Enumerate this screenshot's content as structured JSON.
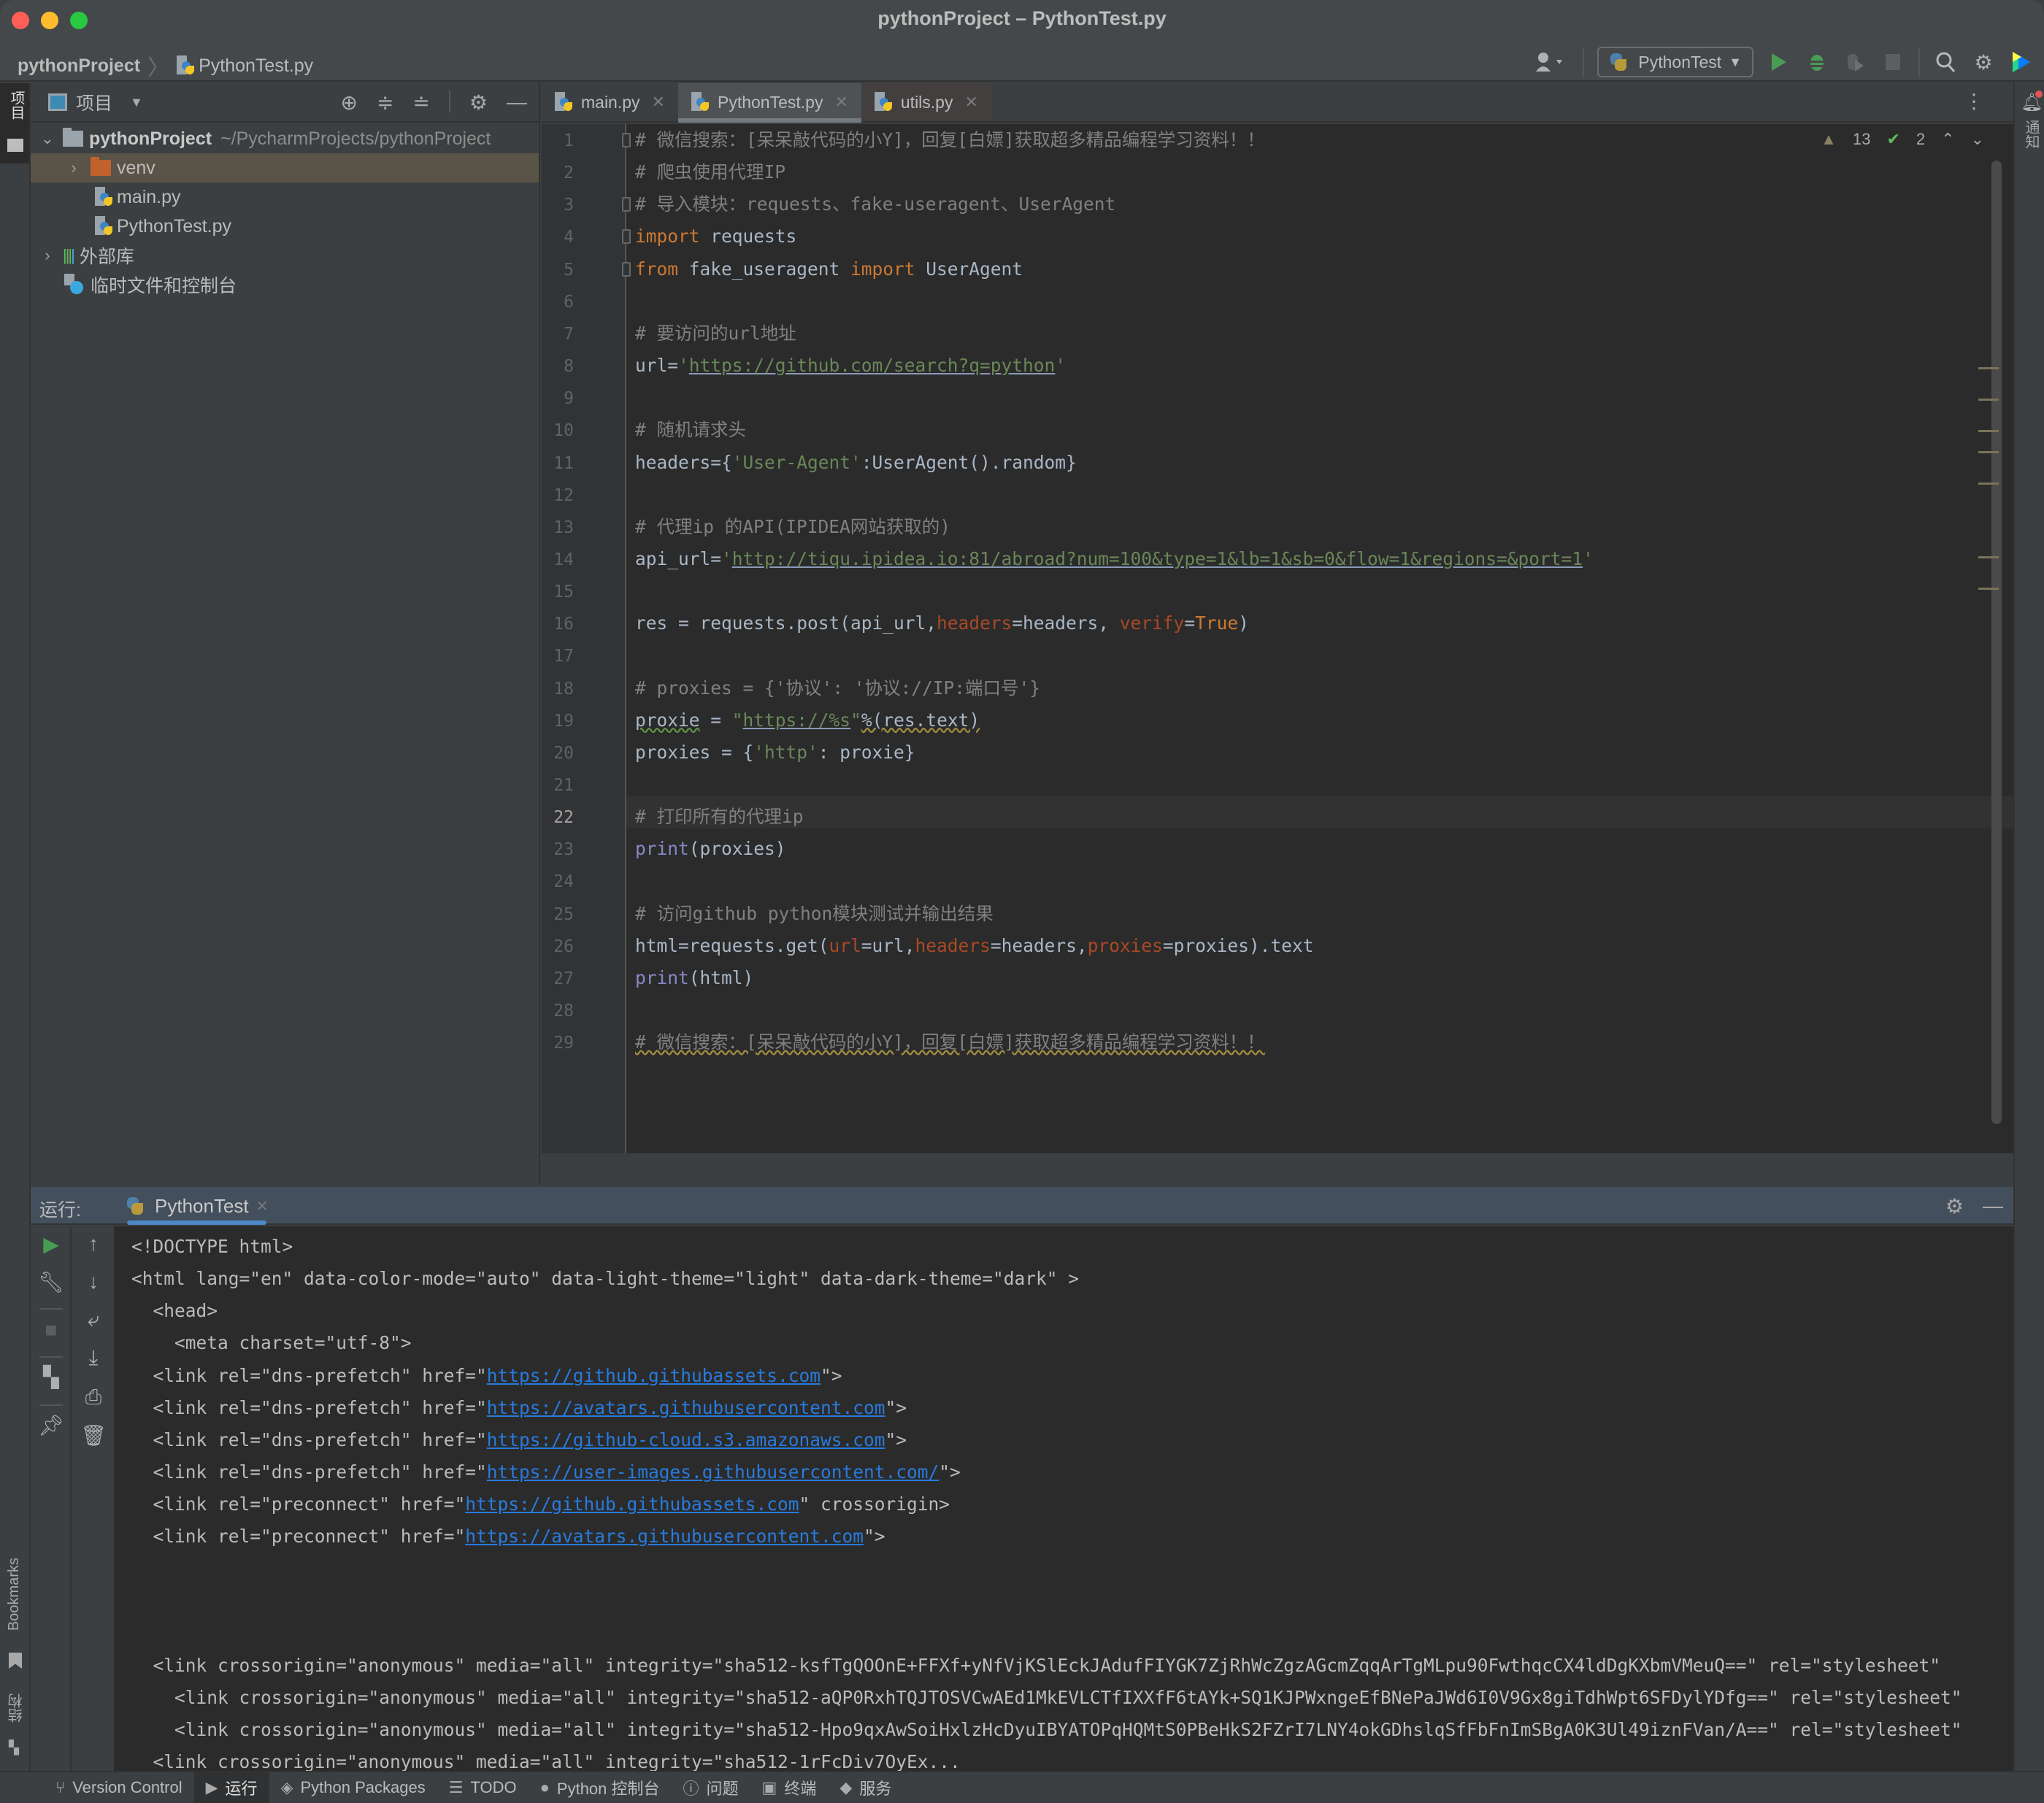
{
  "window": {
    "title": "pythonProject – PythonTest.py",
    "traffic_lights": {
      "close": "#ff5f57",
      "minimize": "#febc2e",
      "maximize": "#28c840"
    }
  },
  "navbar": {
    "breadcrumb": [
      "pythonProject",
      "PythonTest.py"
    ],
    "run_config": "PythonTest",
    "icons": [
      "user-icon",
      "run-icon",
      "debug-icon",
      "coverage-icon",
      "stop-icon",
      "search-icon",
      "settings-icon",
      "jetbrains-logo-icon"
    ]
  },
  "left_strip": {
    "top_label": "项目",
    "bottom_labels": [
      "Bookmarks",
      "结构"
    ]
  },
  "right_strip": {
    "label": "通知"
  },
  "project_panel": {
    "title": "项目",
    "tree": [
      {
        "label": "pythonProject",
        "path": "~/PycharmProjects/pythonProject",
        "type": "root",
        "expanded": true
      },
      {
        "label": "venv",
        "type": "folder",
        "expanded": false,
        "selected": true
      },
      {
        "label": "main.py",
        "type": "python-file"
      },
      {
        "label": "PythonTest.py",
        "type": "python-file"
      },
      {
        "label": "外部库",
        "type": "library",
        "expanded": false
      },
      {
        "label": "临时文件和控制台",
        "type": "scratches"
      }
    ]
  },
  "editor": {
    "tabs": [
      {
        "label": "main.py",
        "active": false
      },
      {
        "label": "PythonTest.py",
        "active": true
      },
      {
        "label": "utils.py",
        "active": false
      }
    ],
    "warnings": "13",
    "weak_warnings": "2",
    "current_line": 22,
    "lines": [
      {
        "n": "1",
        "text": "# 微信搜索：[呆呆敲代码的小Y]，回复[白嫖]获取超多精品编程学习资料！！"
      },
      {
        "n": "2",
        "text": "# 爬虫使用代理IP"
      },
      {
        "n": "3",
        "text": "# 导入模块：requests、fake-useragent、UserAgent"
      },
      {
        "n": "4",
        "kw": "import",
        "rest": " requests"
      },
      {
        "n": "5",
        "kw": "from",
        "mid": " fake_useragent ",
        "kw2": "import",
        "rest": " UserAgent"
      },
      {
        "n": "6",
        "text": ""
      },
      {
        "n": "7",
        "text": "# 要访问的url地址"
      },
      {
        "n": "8",
        "pre": "url=",
        "q1": "'",
        "url": "https://github.com/search?q=python",
        "q2": "'"
      },
      {
        "n": "9",
        "text": ""
      },
      {
        "n": "10",
        "text": "# 随机请求头"
      },
      {
        "n": "11",
        "pre": "headers={",
        "str": "'User-Agent'",
        "rest": ":UserAgent().random}"
      },
      {
        "n": "12",
        "text": ""
      },
      {
        "n": "13",
        "text": "# 代理ip 的API(IPIDEA网站获取的)"
      },
      {
        "n": "14",
        "pre": "api_url=",
        "q1": "'",
        "url": "http://tiqu.ipidea.io:81/abroad?num=100&type=1&lb=1&sb=0&flow=1&regions=&port=1",
        "q2": "'"
      },
      {
        "n": "15",
        "text": ""
      },
      {
        "n": "16",
        "a": "res = requests.post(api_url,",
        "p1": "headers",
        "b": "=headers, ",
        "p2": "verify",
        "c": "=",
        "t": "True",
        "d": ")"
      },
      {
        "n": "17",
        "text": ""
      },
      {
        "n": "18",
        "text": "# proxies = {'协议': '协议://IP:端口号'}"
      },
      {
        "n": "19",
        "pre": "proxie",
        "mid": " = ",
        "q1": "\"",
        "url": "https://%s",
        "q2": "\"",
        "rest": "%(res.text)"
      },
      {
        "n": "20",
        "pre": "proxies = {",
        "str": "'http'",
        "rest": ": proxie}"
      },
      {
        "n": "21",
        "text": ""
      },
      {
        "n": "22",
        "text": "# 打印所有的代理ip"
      },
      {
        "n": "23",
        "bi": "print",
        "rest": "(proxies)"
      },
      {
        "n": "24",
        "text": ""
      },
      {
        "n": "25",
        "text": "# 访问github python模块测试并输出结果"
      },
      {
        "n": "26",
        "a": "html=requests.get(",
        "p1": "url",
        "b": "=url,",
        "p2": "headers",
        "c": "=headers,",
        "p3": "proxies",
        "d": "=proxies).text"
      },
      {
        "n": "27",
        "bi": "print",
        "rest": "(html)"
      },
      {
        "n": "28",
        "text": ""
      },
      {
        "n": "29",
        "text": "# 微信搜索：[呆呆敲代码的小Y]，回复[白嫖]获取超多精品编程学习资料！！"
      }
    ]
  },
  "run_panel": {
    "label": "运行:",
    "tab": "PythonTest",
    "output": [
      {
        "text": "<!DOCTYPE html>"
      },
      {
        "text": "<html lang=\"en\" data-color-mode=\"auto\" data-light-theme=\"light\" data-dark-theme=\"dark\" >"
      },
      {
        "text": "  <head>"
      },
      {
        "text": "    <meta charset=\"utf-8\">"
      },
      {
        "pre": "  <link rel=\"dns-prefetch\" href=\"",
        "link": "https://github.githubassets.com",
        "post": "\">"
      },
      {
        "pre": "  <link rel=\"dns-prefetch\" href=\"",
        "link": "https://avatars.githubusercontent.com",
        "post": "\">"
      },
      {
        "pre": "  <link rel=\"dns-prefetch\" href=\"",
        "link": "https://github-cloud.s3.amazonaws.com",
        "post": "\">"
      },
      {
        "pre": "  <link rel=\"dns-prefetch\" href=\"",
        "link": "https://user-images.githubusercontent.com/",
        "post": "\">"
      },
      {
        "pre": "  <link rel=\"preconnect\" href=\"",
        "link": "https://github.githubassets.com",
        "post": "\" crossorigin>"
      },
      {
        "pre": "  <link rel=\"preconnect\" href=\"",
        "link": "https://avatars.githubusercontent.com",
        "post": "\">"
      },
      {
        "text": ""
      },
      {
        "text": ""
      },
      {
        "text": ""
      },
      {
        "text": "  <link crossorigin=\"anonymous\" media=\"all\" integrity=\"sha512-ksfTgQOOnE+FFXf+yNfVjKSlEckJAdufFIYGK7ZjRhWcZgzAGcmZqqArTgMLpu90FwthqcCX4ldDgKXbmVMeuQ==\" rel=\"stylesheet\""
      },
      {
        "text": "    <link crossorigin=\"anonymous\" media=\"all\" integrity=\"sha512-aQP0RxhTQJTOSVCwAEd1MkEVLCTfIXXfF6tAYk+SQ1KJPWxngeEfBNePaJWd6I0V9Gx8giTdhWpt6SFDylYDfg==\" rel=\"stylesheet\""
      },
      {
        "text": "    <link crossorigin=\"anonymous\" media=\"all\" integrity=\"sha512-Hpo9qxAwSoiHxlzHcDyuIBYATOPqHQMtS0PBeHkS2FZrI7LNY4okGDhslqSfFbFnImSBgA0K3Ul49iznFVan/A==\" rel=\"stylesheet\""
      },
      {
        "text": "  <link crossorigin=\"anonymous\" media=\"all\" integrity=\"sha512-1rFcDiv7OyEx..."
      }
    ],
    "tools_left": [
      "rerun-icon",
      "wrench-icon",
      "stop-icon",
      "layout-icon",
      "pin-icon"
    ],
    "tools_right": [
      "up-arrow-icon",
      "down-arrow-icon",
      "soft-wrap-icon",
      "scroll-to-end-icon",
      "print-icon",
      "trash-icon"
    ]
  },
  "statusbar": {
    "items": [
      {
        "label": "Version Control",
        "icon": "branch-icon"
      },
      {
        "label": "运行",
        "icon": "run-icon",
        "active": true
      },
      {
        "label": "Python Packages",
        "icon": "packages-icon"
      },
      {
        "label": "TODO",
        "icon": "list-icon"
      },
      {
        "label": "Python 控制台",
        "icon": "python-console-icon"
      },
      {
        "label": "问题",
        "icon": "problems-icon"
      },
      {
        "label": "终端",
        "icon": "terminal-icon"
      },
      {
        "label": "服务",
        "icon": "services-icon"
      }
    ]
  }
}
